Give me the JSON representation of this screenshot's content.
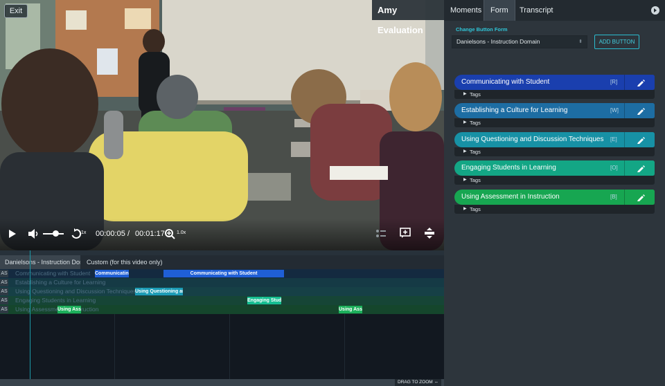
{
  "video": {
    "exit_label": "Exit",
    "title": "Amy Evaluation",
    "controls": {
      "current_time": "00:00:05",
      "separator": "/",
      "duration": "00:01:17",
      "replay_rate": "1x",
      "zoom": "1.0x"
    }
  },
  "timeline": {
    "form_tabs": [
      "Danielsons - Instruction Dom...",
      "Custom (for this video only)"
    ],
    "tracks": [
      {
        "code": "AS",
        "label": "Communicating with Student",
        "segments": [
          {
            "text": "Communicating",
            "color": "#1f5fd6"
          },
          {
            "text": "Communicating with Student",
            "color": "#1f5fd6"
          }
        ]
      },
      {
        "code": "AS",
        "label": "Establishing a Culture for Learning",
        "segments": []
      },
      {
        "code": "AS",
        "label": "Using Questioning and Discussion Techniques",
        "segments": [
          {
            "text": "Using Questioning and",
            "color": "#1c9cb6"
          }
        ]
      },
      {
        "code": "AS",
        "label": "Engaging Students in Learning",
        "segments": [
          {
            "text": "Engaging Stude",
            "color": "#16bf92"
          }
        ]
      },
      {
        "code": "AS",
        "label": "Using Assessment in Instruction",
        "segments": [
          {
            "text": "Using Asse",
            "color": "#1db05c"
          },
          {
            "text": "Using Asse",
            "color": "#1db05c"
          }
        ]
      }
    ],
    "drag_to_zoom": "DRAG TO ZOOM"
  },
  "panel": {
    "tabs": [
      "Moments",
      "Form",
      "Transcript"
    ],
    "active_tab": "Form",
    "change_form_label": "Change Button Form",
    "form_select_value": "Danielsons - Instruction Domain",
    "add_button_label": "ADD BUTTON",
    "domains": [
      {
        "name": "Communicating with Student",
        "key": "[R]",
        "tags": "Tags",
        "color": "#1a3fae"
      },
      {
        "name": "Establishing a Culture for Learning",
        "key": "[W]",
        "tags": "Tags",
        "color": "#1d6da3"
      },
      {
        "name": "Using Questioning and Discussion Techniques",
        "key": "[E]",
        "tags": "Tags",
        "color": "#1791a5"
      },
      {
        "name": "Engaging Students in Learning",
        "key": "[O]",
        "tags": "Tags",
        "color": "#13a685"
      },
      {
        "name": "Using Assessment in Instruction",
        "key": "[B]",
        "tags": "Tags",
        "color": "#17a651"
      }
    ]
  },
  "colors": {
    "accent": "#2bbdd0",
    "panel_bg": "#2d353c",
    "timeline_bg": "#121820"
  }
}
